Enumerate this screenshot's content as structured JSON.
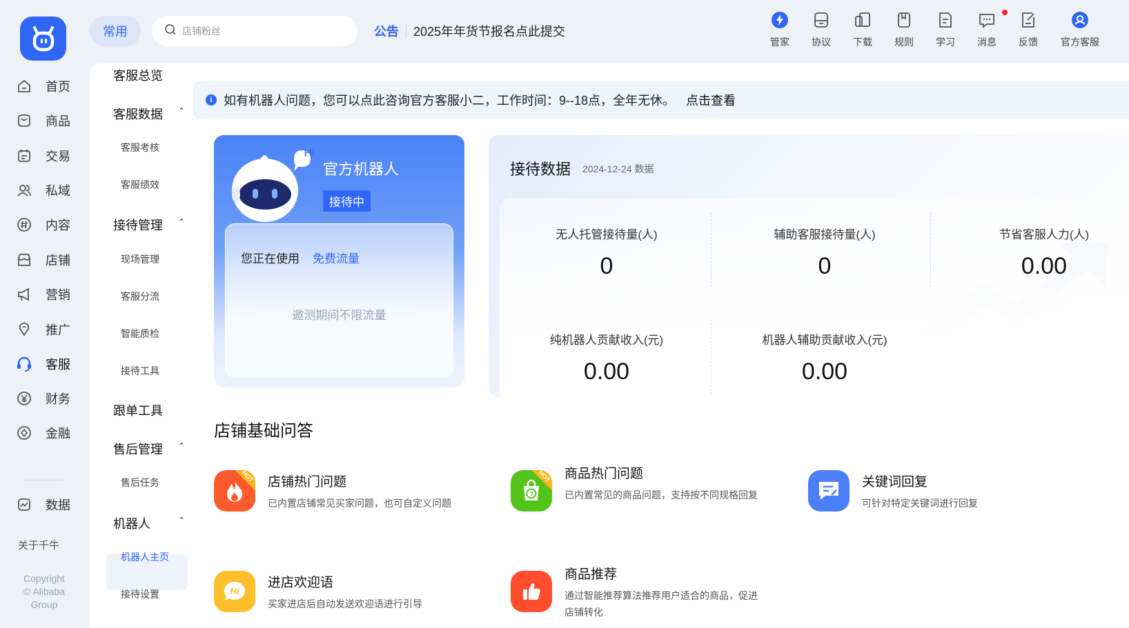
{
  "rail": {
    "items": [
      {
        "label": "首页",
        "icon": "home-icon"
      },
      {
        "label": "商品",
        "icon": "product-icon"
      },
      {
        "label": "交易",
        "icon": "trade-icon"
      },
      {
        "label": "私域",
        "icon": "users-icon"
      },
      {
        "label": "内容",
        "icon": "hashtag-icon"
      },
      {
        "label": "店铺",
        "icon": "shop-icon"
      },
      {
        "label": "营销",
        "icon": "megaphone-icon"
      },
      {
        "label": "推广",
        "icon": "pin-icon"
      },
      {
        "label": "客服",
        "icon": "headset-icon",
        "active": true
      },
      {
        "label": "财务",
        "icon": "yuan-icon"
      },
      {
        "label": "金融",
        "icon": "target-icon"
      },
      {
        "label": "数据",
        "icon": "chart-icon"
      }
    ],
    "about": "关于千牛",
    "copyright": [
      "Copyright",
      "© Alibaba",
      "Group"
    ]
  },
  "topbar": {
    "chip": "常用",
    "search_placeholder": "店铺粉丝",
    "notice_tag": "公告",
    "notice_text": "2025年年货节报名点此提交",
    "tools": [
      {
        "label": "管家",
        "icon": "butler-icon"
      },
      {
        "label": "协议",
        "icon": "agreement-icon"
      },
      {
        "label": "下载",
        "icon": "download-icon"
      },
      {
        "label": "规则",
        "icon": "rules-icon"
      },
      {
        "label": "学习",
        "icon": "study-icon"
      },
      {
        "label": "消息",
        "icon": "message-icon",
        "has_dot": true
      },
      {
        "label": "反馈",
        "icon": "feedback-icon"
      },
      {
        "label": "官方客服",
        "icon": "service-icon"
      }
    ]
  },
  "subnav": {
    "overview": "客服总览",
    "group_data": "客服数据",
    "data_items": [
      "客服考核",
      "客服绩效"
    ],
    "group_reception": "接待管理",
    "reception_items": [
      "现场管理",
      "客服分流",
      "智能质检",
      "接待工具"
    ],
    "order_tools": "跟单工具",
    "group_aftersale": "售后管理",
    "aftersale_items": [
      "售后任务"
    ],
    "group_robot": "机器人",
    "robot_items": [
      "机器人主页",
      "接待设置"
    ]
  },
  "banner": {
    "text": "如有机器人问题，您可以点此咨询官方客服小二，工作时间：9--18点，全年无休。",
    "link": "点击查看"
  },
  "robot": {
    "hi": "Hi",
    "title": "官方机器人",
    "status": "接待中",
    "using_label": "您正在使用",
    "plan": "免费流量",
    "note": "邀测期间不限流量"
  },
  "stats": {
    "title": "接待数据",
    "date": "2024-12-24 数据",
    "metrics": [
      {
        "label": "无人托管接待量(人)",
        "value": "0"
      },
      {
        "label": "辅助客服接待量(人)",
        "value": "0"
      },
      {
        "label": "节省客服人力(人)",
        "value": "0.00"
      },
      {
        "label": "纯机器人贡献收入(元)",
        "value": "0.00"
      },
      {
        "label": "机器人辅助贡献收入(元)",
        "value": "0.00"
      }
    ]
  },
  "qa": {
    "title": "店铺基础问答",
    "hot_tag": "HOT",
    "features": [
      {
        "title": "店铺热门问题",
        "desc": "已内置店铺常见买家问题，也可自定义问题",
        "color": "#ff5a2c"
      },
      {
        "title": "商品热门问题",
        "desc": "已内置常见的商品问题，支持按不同规格回复",
        "color": "#52c41a"
      },
      {
        "title": "关键词回复",
        "desc": "可针对特定关键词进行回复",
        "color": "#4a7ff7"
      },
      {
        "title": "进店欢迎语",
        "desc": "买家进店后自动发送欢迎语进行引导",
        "color": "#ffbf2b"
      },
      {
        "title": "商品推荐",
        "desc": "通过智能推荐算法推荐用户适合的商品，促进店铺转化",
        "color": "#ff4d2e"
      }
    ]
  }
}
